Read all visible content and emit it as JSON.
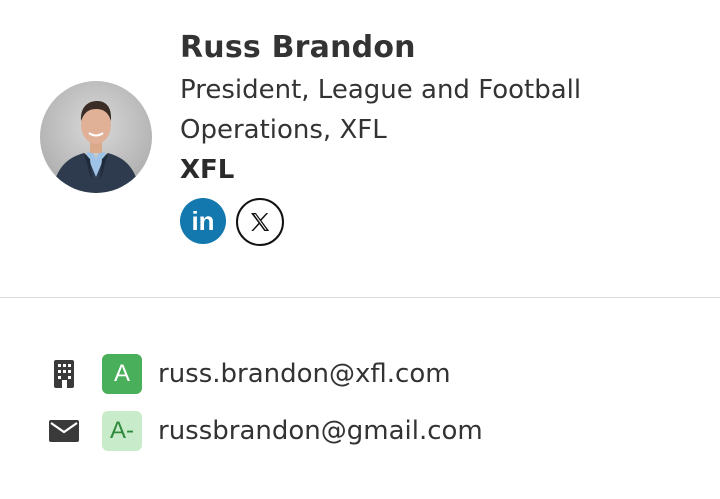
{
  "person": {
    "name": "Russ Brandon",
    "title": "President, League and Football Operations, XFL",
    "company": "XFL"
  },
  "socials": [
    {
      "network": "LinkedIn",
      "icon": "linkedin-icon",
      "glyph": "in",
      "color": "#1378ae"
    },
    {
      "network": "X",
      "icon": "x-icon",
      "color": "#111111"
    }
  ],
  "contacts": [
    {
      "type_icon": "building-icon",
      "grade": "A",
      "grade_color": "#4aaf5b",
      "email": "russ.brandon@xfl.com"
    },
    {
      "type_icon": "envelope-icon",
      "grade": "A-",
      "grade_color": "#c8ecc9",
      "email": "russbrandon@gmail.com"
    }
  ]
}
